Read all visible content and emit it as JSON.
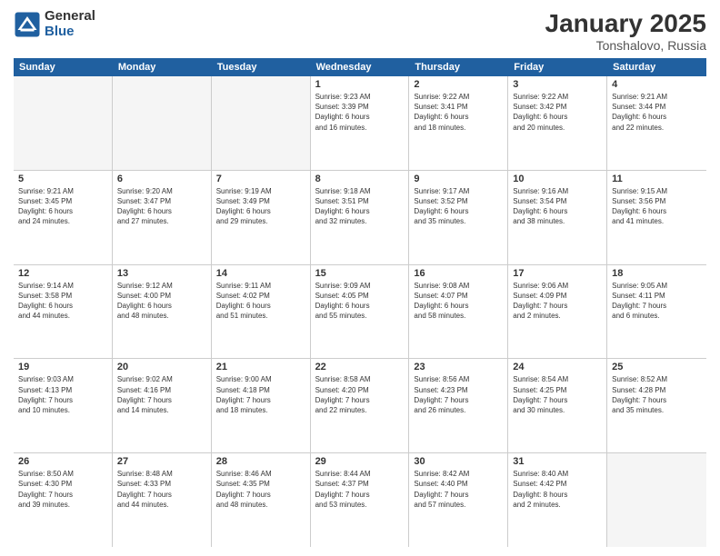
{
  "logo": {
    "general": "General",
    "blue": "Blue"
  },
  "title": "January 2025",
  "location": "Tonshalovo, Russia",
  "weekdays": [
    "Sunday",
    "Monday",
    "Tuesday",
    "Wednesday",
    "Thursday",
    "Friday",
    "Saturday"
  ],
  "weeks": [
    [
      {
        "day": "",
        "info": ""
      },
      {
        "day": "",
        "info": ""
      },
      {
        "day": "",
        "info": ""
      },
      {
        "day": "1",
        "info": "Sunrise: 9:23 AM\nSunset: 3:39 PM\nDaylight: 6 hours\nand 16 minutes."
      },
      {
        "day": "2",
        "info": "Sunrise: 9:22 AM\nSunset: 3:41 PM\nDaylight: 6 hours\nand 18 minutes."
      },
      {
        "day": "3",
        "info": "Sunrise: 9:22 AM\nSunset: 3:42 PM\nDaylight: 6 hours\nand 20 minutes."
      },
      {
        "day": "4",
        "info": "Sunrise: 9:21 AM\nSunset: 3:44 PM\nDaylight: 6 hours\nand 22 minutes."
      }
    ],
    [
      {
        "day": "5",
        "info": "Sunrise: 9:21 AM\nSunset: 3:45 PM\nDaylight: 6 hours\nand 24 minutes."
      },
      {
        "day": "6",
        "info": "Sunrise: 9:20 AM\nSunset: 3:47 PM\nDaylight: 6 hours\nand 27 minutes."
      },
      {
        "day": "7",
        "info": "Sunrise: 9:19 AM\nSunset: 3:49 PM\nDaylight: 6 hours\nand 29 minutes."
      },
      {
        "day": "8",
        "info": "Sunrise: 9:18 AM\nSunset: 3:51 PM\nDaylight: 6 hours\nand 32 minutes."
      },
      {
        "day": "9",
        "info": "Sunrise: 9:17 AM\nSunset: 3:52 PM\nDaylight: 6 hours\nand 35 minutes."
      },
      {
        "day": "10",
        "info": "Sunrise: 9:16 AM\nSunset: 3:54 PM\nDaylight: 6 hours\nand 38 minutes."
      },
      {
        "day": "11",
        "info": "Sunrise: 9:15 AM\nSunset: 3:56 PM\nDaylight: 6 hours\nand 41 minutes."
      }
    ],
    [
      {
        "day": "12",
        "info": "Sunrise: 9:14 AM\nSunset: 3:58 PM\nDaylight: 6 hours\nand 44 minutes."
      },
      {
        "day": "13",
        "info": "Sunrise: 9:12 AM\nSunset: 4:00 PM\nDaylight: 6 hours\nand 48 minutes."
      },
      {
        "day": "14",
        "info": "Sunrise: 9:11 AM\nSunset: 4:02 PM\nDaylight: 6 hours\nand 51 minutes."
      },
      {
        "day": "15",
        "info": "Sunrise: 9:09 AM\nSunset: 4:05 PM\nDaylight: 6 hours\nand 55 minutes."
      },
      {
        "day": "16",
        "info": "Sunrise: 9:08 AM\nSunset: 4:07 PM\nDaylight: 6 hours\nand 58 minutes."
      },
      {
        "day": "17",
        "info": "Sunrise: 9:06 AM\nSunset: 4:09 PM\nDaylight: 7 hours\nand 2 minutes."
      },
      {
        "day": "18",
        "info": "Sunrise: 9:05 AM\nSunset: 4:11 PM\nDaylight: 7 hours\nand 6 minutes."
      }
    ],
    [
      {
        "day": "19",
        "info": "Sunrise: 9:03 AM\nSunset: 4:13 PM\nDaylight: 7 hours\nand 10 minutes."
      },
      {
        "day": "20",
        "info": "Sunrise: 9:02 AM\nSunset: 4:16 PM\nDaylight: 7 hours\nand 14 minutes."
      },
      {
        "day": "21",
        "info": "Sunrise: 9:00 AM\nSunset: 4:18 PM\nDaylight: 7 hours\nand 18 minutes."
      },
      {
        "day": "22",
        "info": "Sunrise: 8:58 AM\nSunset: 4:20 PM\nDaylight: 7 hours\nand 22 minutes."
      },
      {
        "day": "23",
        "info": "Sunrise: 8:56 AM\nSunset: 4:23 PM\nDaylight: 7 hours\nand 26 minutes."
      },
      {
        "day": "24",
        "info": "Sunrise: 8:54 AM\nSunset: 4:25 PM\nDaylight: 7 hours\nand 30 minutes."
      },
      {
        "day": "25",
        "info": "Sunrise: 8:52 AM\nSunset: 4:28 PM\nDaylight: 7 hours\nand 35 minutes."
      }
    ],
    [
      {
        "day": "26",
        "info": "Sunrise: 8:50 AM\nSunset: 4:30 PM\nDaylight: 7 hours\nand 39 minutes."
      },
      {
        "day": "27",
        "info": "Sunrise: 8:48 AM\nSunset: 4:33 PM\nDaylight: 7 hours\nand 44 minutes."
      },
      {
        "day": "28",
        "info": "Sunrise: 8:46 AM\nSunset: 4:35 PM\nDaylight: 7 hours\nand 48 minutes."
      },
      {
        "day": "29",
        "info": "Sunrise: 8:44 AM\nSunset: 4:37 PM\nDaylight: 7 hours\nand 53 minutes."
      },
      {
        "day": "30",
        "info": "Sunrise: 8:42 AM\nSunset: 4:40 PM\nDaylight: 7 hours\nand 57 minutes."
      },
      {
        "day": "31",
        "info": "Sunrise: 8:40 AM\nSunset: 4:42 PM\nDaylight: 8 hours\nand 2 minutes."
      },
      {
        "day": "",
        "info": ""
      }
    ]
  ]
}
